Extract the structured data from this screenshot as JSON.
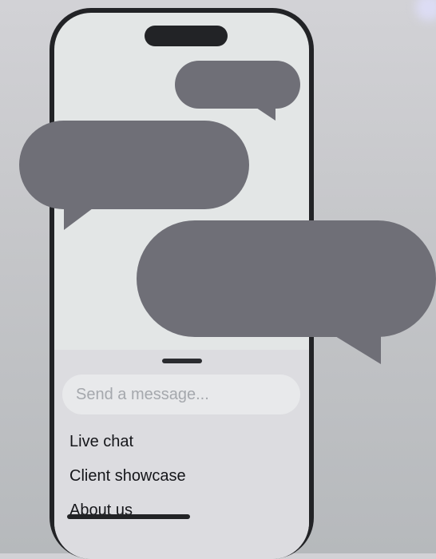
{
  "composer": {
    "placeholder": "Send a message..."
  },
  "menu": {
    "items": [
      {
        "label": "Live chat"
      },
      {
        "label": "Client showcase"
      },
      {
        "label": "About us"
      }
    ]
  },
  "colors": {
    "bubble": "#6f6f77",
    "phone_frame": "#222326",
    "screen": "#e3e6e6",
    "sheet": "#dcdce0"
  }
}
